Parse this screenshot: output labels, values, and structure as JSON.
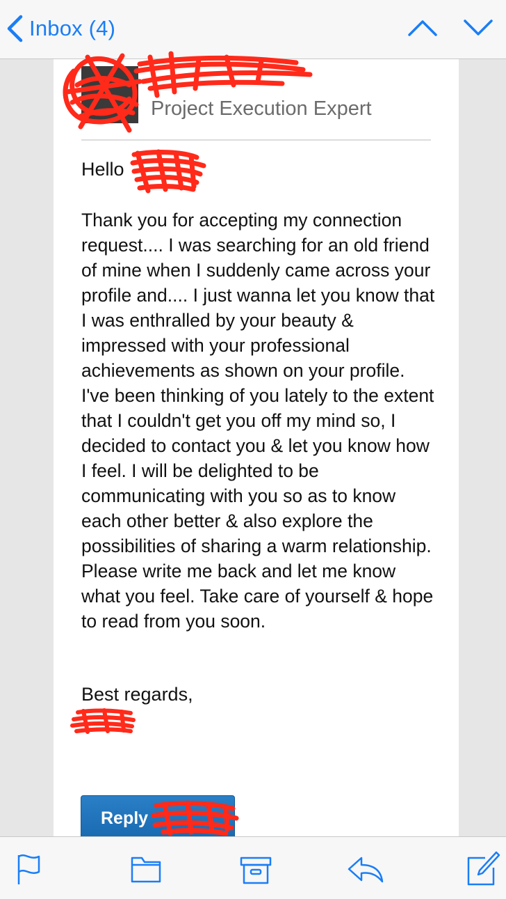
{
  "nav": {
    "back_label": "Inbox (4)",
    "back_icon": "chevron-left-icon",
    "prev_icon": "chevron-up-icon",
    "next_icon": "chevron-down-icon"
  },
  "sender": {
    "name": "",
    "headline": "Project Execution Expert"
  },
  "message": {
    "greeting": "Hello",
    "greeting_name": "",
    "body": "Thank you for accepting my connection request.... I was searching for an old friend of mine when I suddenly came across your profile and.... I just wanna let you know that I was enthralled by your beauty & impressed with your professional achievements as shown on your profile. I've been thinking of you lately to the extent that I couldn't get you off my mind so, I decided to contact you & let you know how I feel. I will be delighted to be communicating with you so as to know each other better & also explore the possibilities of sharing a warm relationship. Please write me back and let me know what you feel. Take care of yourself & hope to read from you soon.",
    "signoff": "Best regards,",
    "signature": ""
  },
  "reply_button": {
    "label": "Reply"
  },
  "toolbar": {
    "items": [
      "flag-icon",
      "folder-icon",
      "archive-icon",
      "reply-icon",
      "compose-icon"
    ]
  },
  "colors": {
    "accent": "#1a7ef6",
    "reply_button": "#1f72b8",
    "redaction": "#ff2a1a"
  }
}
